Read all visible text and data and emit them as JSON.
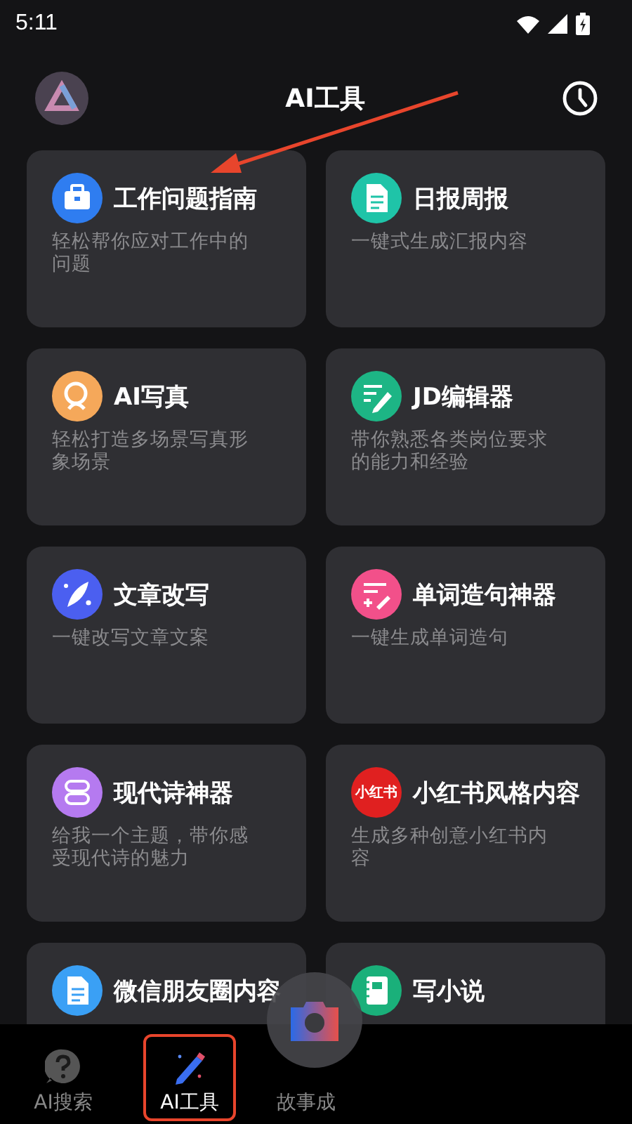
{
  "status_bar": {
    "time": "5:11"
  },
  "header": {
    "title": "AI工具"
  },
  "tools": [
    {
      "title": "工作问题指南",
      "description": "轻松帮你应对工作中的问题",
      "color": "#2f7df0"
    },
    {
      "title": "日报周报",
      "description": "一键式生成汇报内容",
      "color": "#1fc4a8"
    },
    {
      "title": "AI写真",
      "description": "轻松打造多场景写真形象场景",
      "color": "#f5a85a"
    },
    {
      "title": "JD编辑器",
      "description": "带你熟悉各类岗位要求的能力和经验",
      "color": "#1db585"
    },
    {
      "title": "文章改写",
      "description": "一键改写文章文案",
      "color": "#4b5ff0"
    },
    {
      "title": "单词造句神器",
      "description": "一键生成单词造句",
      "color": "#f2508a"
    },
    {
      "title": "现代诗神器",
      "description": "给我一个主题，带你感受现代诗的魅力",
      "color": "#b57af0"
    },
    {
      "title": "小红书风格内容",
      "description": "生成多种创意小红书内容",
      "color": "#e02020",
      "icon_text": "小红书"
    },
    {
      "title": "微信朋友圈内容",
      "color": "#3aa0f5"
    },
    {
      "title": "写小说",
      "color": "#1ab07a"
    }
  ],
  "nav": {
    "items": [
      {
        "label": "AI搜索",
        "selected": false
      },
      {
        "label": "AI工具",
        "selected": true
      },
      {
        "label": "故事成",
        "selected": false
      }
    ]
  }
}
